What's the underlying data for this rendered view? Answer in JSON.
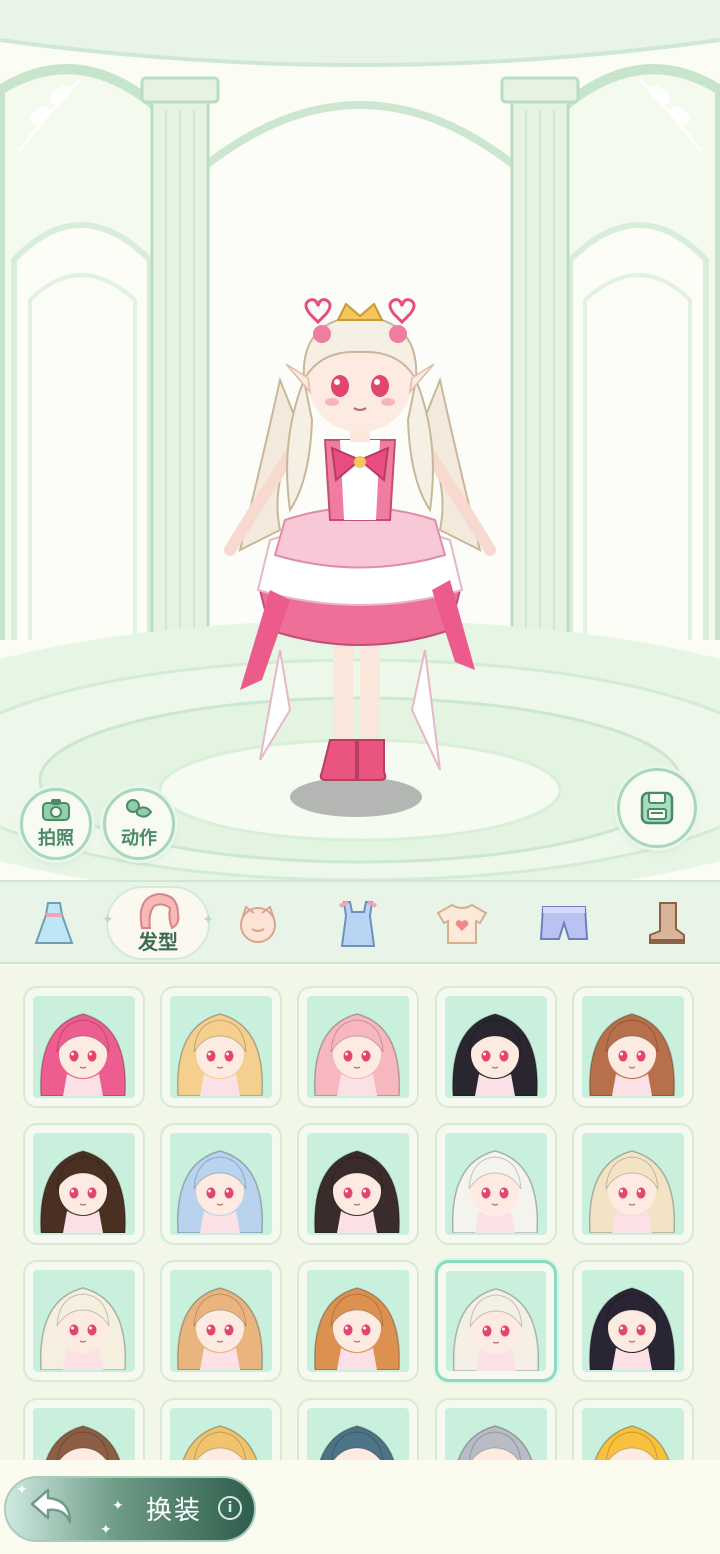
{
  "scene": {
    "photo_label": "拍照",
    "action_label": "动作",
    "save_icon": "floppy-disk-icon"
  },
  "tabs": {
    "items": [
      {
        "id": "dress",
        "icon": "dress-icon"
      },
      {
        "id": "hairstyle",
        "icon": "hair-icon",
        "label": "发型",
        "active": true
      },
      {
        "id": "face",
        "icon": "face-icon"
      },
      {
        "id": "overalls",
        "icon": "overalls-icon"
      },
      {
        "id": "top",
        "icon": "tshirt-icon"
      },
      {
        "id": "bottoms",
        "icon": "shorts-icon"
      },
      {
        "id": "shoes",
        "icon": "boot-icon"
      }
    ]
  },
  "grid": {
    "selected_index": 13,
    "hairstyles": [
      {
        "hair": "#ee5d8f"
      },
      {
        "hair": "#f4cf8e"
      },
      {
        "hair": "#f6b7be"
      },
      {
        "hair": "#2a2630"
      },
      {
        "hair": "#b7704b"
      },
      {
        "hair": "#4a3022"
      },
      {
        "hair": "#b9d3ef"
      },
      {
        "hair": "#3a2c2a"
      },
      {
        "hair": "#f5f3ee"
      },
      {
        "hair": "#f2e3c4"
      },
      {
        "hair": "#f6efdf"
      },
      {
        "hair": "#e9b47d"
      },
      {
        "hair": "#dc9150"
      },
      {
        "hair": "#f4f0e6"
      },
      {
        "hair": "#2a2535"
      },
      {
        "hair": "#8b5e45"
      },
      {
        "hair": "#f0c46f"
      },
      {
        "hair": "#4c7486"
      },
      {
        "hair": "#b9bcc6"
      },
      {
        "hair": "#f7c13e"
      }
    ]
  },
  "bottom": {
    "back_icon": "back-arrow-icon",
    "label": "换装",
    "info_icon": "info-icon",
    "info_text": "i"
  },
  "colors": {
    "accent": "#4c8a67",
    "panel": "#e9f4e8",
    "thumb_bg": "#c9f0dc",
    "selected_border": "#89dcc0"
  }
}
